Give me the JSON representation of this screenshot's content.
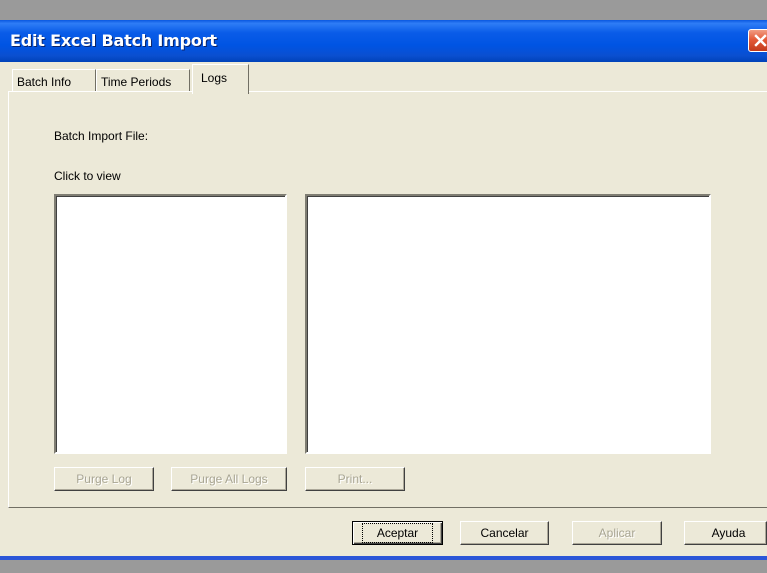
{
  "window": {
    "title": "Edit Excel Batch Import"
  },
  "tabs": [
    {
      "label": "Batch Info",
      "active": false
    },
    {
      "label": "Time Periods",
      "active": false
    },
    {
      "label": "Logs",
      "active": true
    }
  ],
  "logs": {
    "batch_file_label": "Batch Import File:",
    "click_to_view_label": "Click to view",
    "purge_log_button": "Purge Log",
    "purge_all_logs_button": "Purge All Logs",
    "print_button": "Print..."
  },
  "dialog_buttons": {
    "accept": "Aceptar",
    "cancel": "Cancelar",
    "apply": "Aplicar",
    "help": "Ayuda"
  },
  "colors": {
    "face": "#ece9d8",
    "titlebar": "#0054e3",
    "disabled_text": "#a8a593"
  }
}
